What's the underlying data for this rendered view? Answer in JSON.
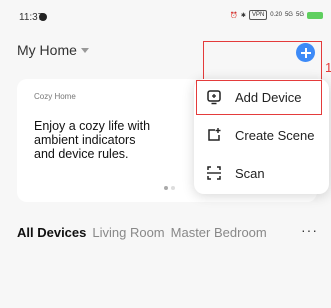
{
  "status_bar": {
    "time": "11:37",
    "icons": [
      "alarm-icon",
      "bluetooth-icon",
      "vpn-badge",
      "data-speed",
      "5g-signal",
      "4g-signal",
      "battery"
    ],
    "vpn_label": "VPN",
    "speed_label": "0.20",
    "signal1_label": "5G",
    "signal2_label": "5G"
  },
  "header": {
    "home_title": "My Home"
  },
  "add_button": {
    "accent": "#3d8af7"
  },
  "annotation": {
    "number": "1",
    "color": "#e43b3b"
  },
  "card": {
    "subtitle": "Cozy Home",
    "text": "Enjoy a cozy life with\nambient indicators\nand device rules."
  },
  "menu": {
    "items": [
      {
        "icon": "add-device-icon",
        "label": "Add Device"
      },
      {
        "icon": "create-scene-icon",
        "label": "Create Scene"
      },
      {
        "icon": "scan-icon",
        "label": "Scan"
      }
    ]
  },
  "tabs": {
    "items": [
      "All Devices",
      "Living Room",
      "Master Bedroom"
    ],
    "active_index": 0,
    "more_label": "···"
  }
}
